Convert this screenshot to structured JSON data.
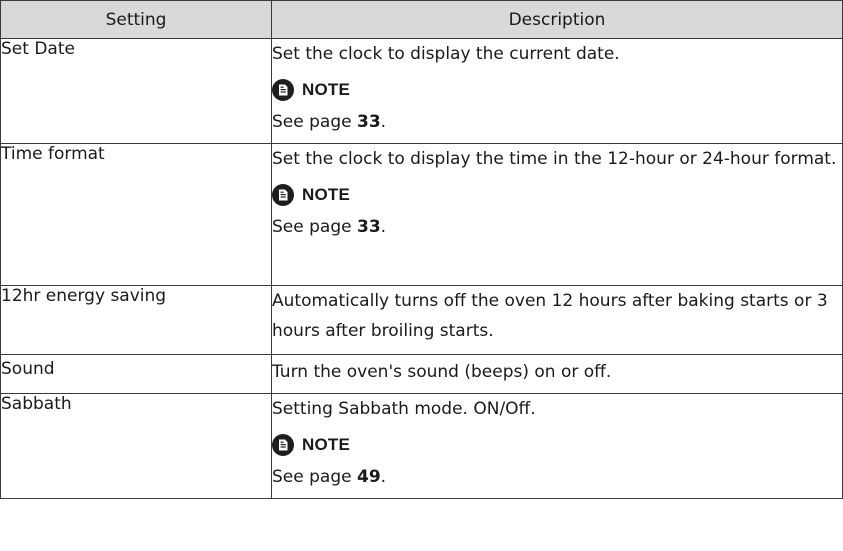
{
  "table": {
    "headers": [
      "Setting",
      "Description"
    ],
    "note_label": "NOTE",
    "see_page_prefix": "See page",
    "rows": [
      {
        "setting": "Set Date",
        "description": "Set the clock to display the current date.",
        "note_page": "33"
      },
      {
        "setting": "Time format",
        "description": "Set the clock to display the time in the 12-hour or 24-hour format.",
        "note_page": "33"
      },
      {
        "setting": "12hr energy saving",
        "description": "Automatically turns off the oven 12 hours after baking starts or 3 hours after broiling starts."
      },
      {
        "setting": "Sound",
        "description": "Turn the oven's sound (beeps) on or off."
      },
      {
        "setting": "Sabbath",
        "description": "Setting Sabbath mode. ON/Off.",
        "note_page": "49"
      }
    ]
  },
  "icons": {
    "note": "note-document-icon"
  }
}
